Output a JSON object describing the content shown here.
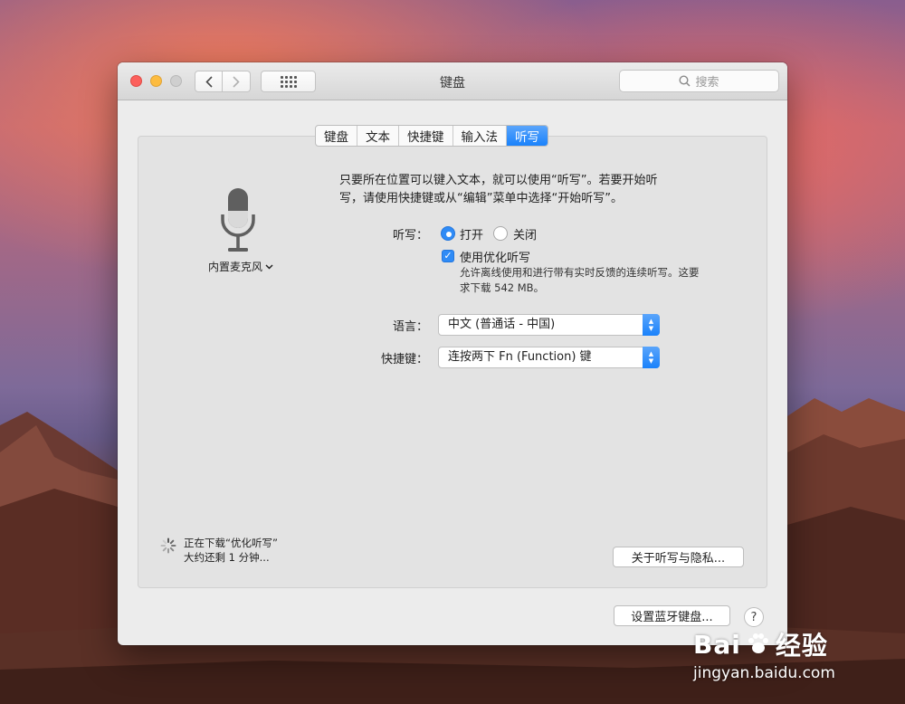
{
  "window": {
    "title": "键盘",
    "search_placeholder": "搜索"
  },
  "tabs": [
    {
      "label": "键盘",
      "active": false
    },
    {
      "label": "文本",
      "active": false
    },
    {
      "label": "快捷键",
      "active": false
    },
    {
      "label": "输入法",
      "active": false
    },
    {
      "label": "听写",
      "active": true
    }
  ],
  "microphone": {
    "label": "内置麦克风",
    "icon": "microphone-icon"
  },
  "description": {
    "line1": "只要所在位置可以键入文本，就可以使用“听写”。若要开始听",
    "line2": "写，请使用快捷键或从“编辑”菜单中选择“开始听写”。"
  },
  "dictation": {
    "label": "听写：",
    "on_label": "打开",
    "off_label": "关闭",
    "selected": "打开",
    "enhanced_label": "使用优化听写",
    "enhanced_checked": true,
    "enhanced_note_line1": "允许离线使用和进行带有实时反馈的连续听写。这要",
    "enhanced_note_line2": "求下载 542 MB。"
  },
  "language": {
    "label": "语言：",
    "value": "中文 (普通话 - 中国)"
  },
  "shortcut": {
    "label": "快捷键：",
    "value": "连按两下 Fn (Function) 键"
  },
  "download_status": {
    "line1": "正在下载“优化听写”",
    "line2": "大约还剩 1 分钟..."
  },
  "buttons": {
    "privacy": "关于听写与隐私...",
    "bluetooth": "设置蓝牙键盘...",
    "help": "?"
  },
  "watermark": {
    "brand": "Bai",
    "brand_suffix": "经验",
    "url": "jingyan.baidu.com"
  },
  "colors": {
    "accent": "#1a82fb",
    "close": "#fc605c",
    "minimize": "#fdbc40"
  }
}
